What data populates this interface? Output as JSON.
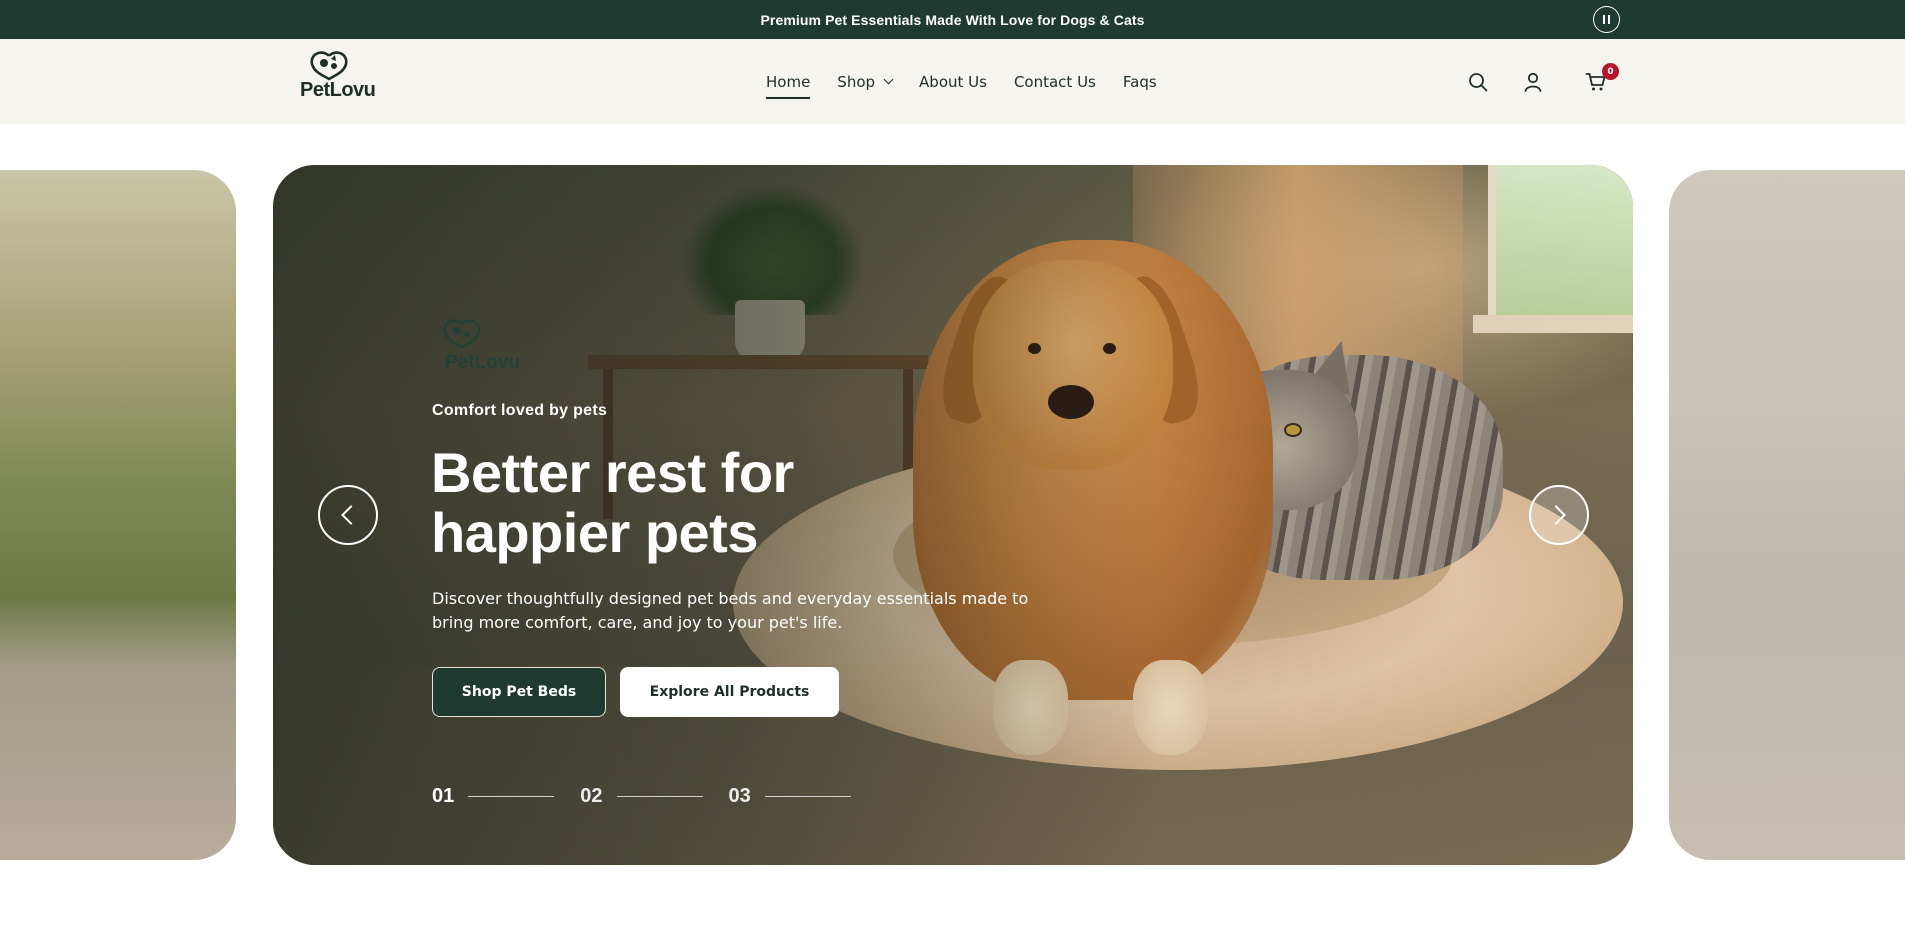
{
  "announcement": {
    "text": "Premium Pet Essentials Made With Love for Dogs & Cats",
    "pause_icon": "pause-icon"
  },
  "brand": {
    "name": "PetLovu",
    "logo_icon": "dog-cat-heart-icon"
  },
  "nav": {
    "items": [
      {
        "label": "Home",
        "active": true
      },
      {
        "label": "Shop",
        "has_dropdown": true
      },
      {
        "label": "About Us"
      },
      {
        "label": "Contact Us"
      },
      {
        "label": "Faqs"
      }
    ]
  },
  "header_icons": {
    "search": "search-icon",
    "account": "user-icon",
    "cart": "cart-icon",
    "cart_count": "0"
  },
  "hero": {
    "eyebrow": "Comfort loved by pets",
    "headline": "Better rest for happier pets",
    "description": "Discover thoughtfully designed pet beds and everyday essentials made to bring more comfort, care, and joy to your pet's life.",
    "primary_button": "Shop Pet Beds",
    "secondary_button": "Explore All Products",
    "slides": [
      "01",
      "02",
      "03"
    ],
    "active_slide": 0,
    "prev_icon": "chevron-left-icon",
    "next_icon": "chevron-right-icon"
  },
  "colors": {
    "primary": "#1f3a30",
    "header_bg": "#f6f4ef",
    "badge": "#b5142b",
    "text": "#1f2e28"
  }
}
